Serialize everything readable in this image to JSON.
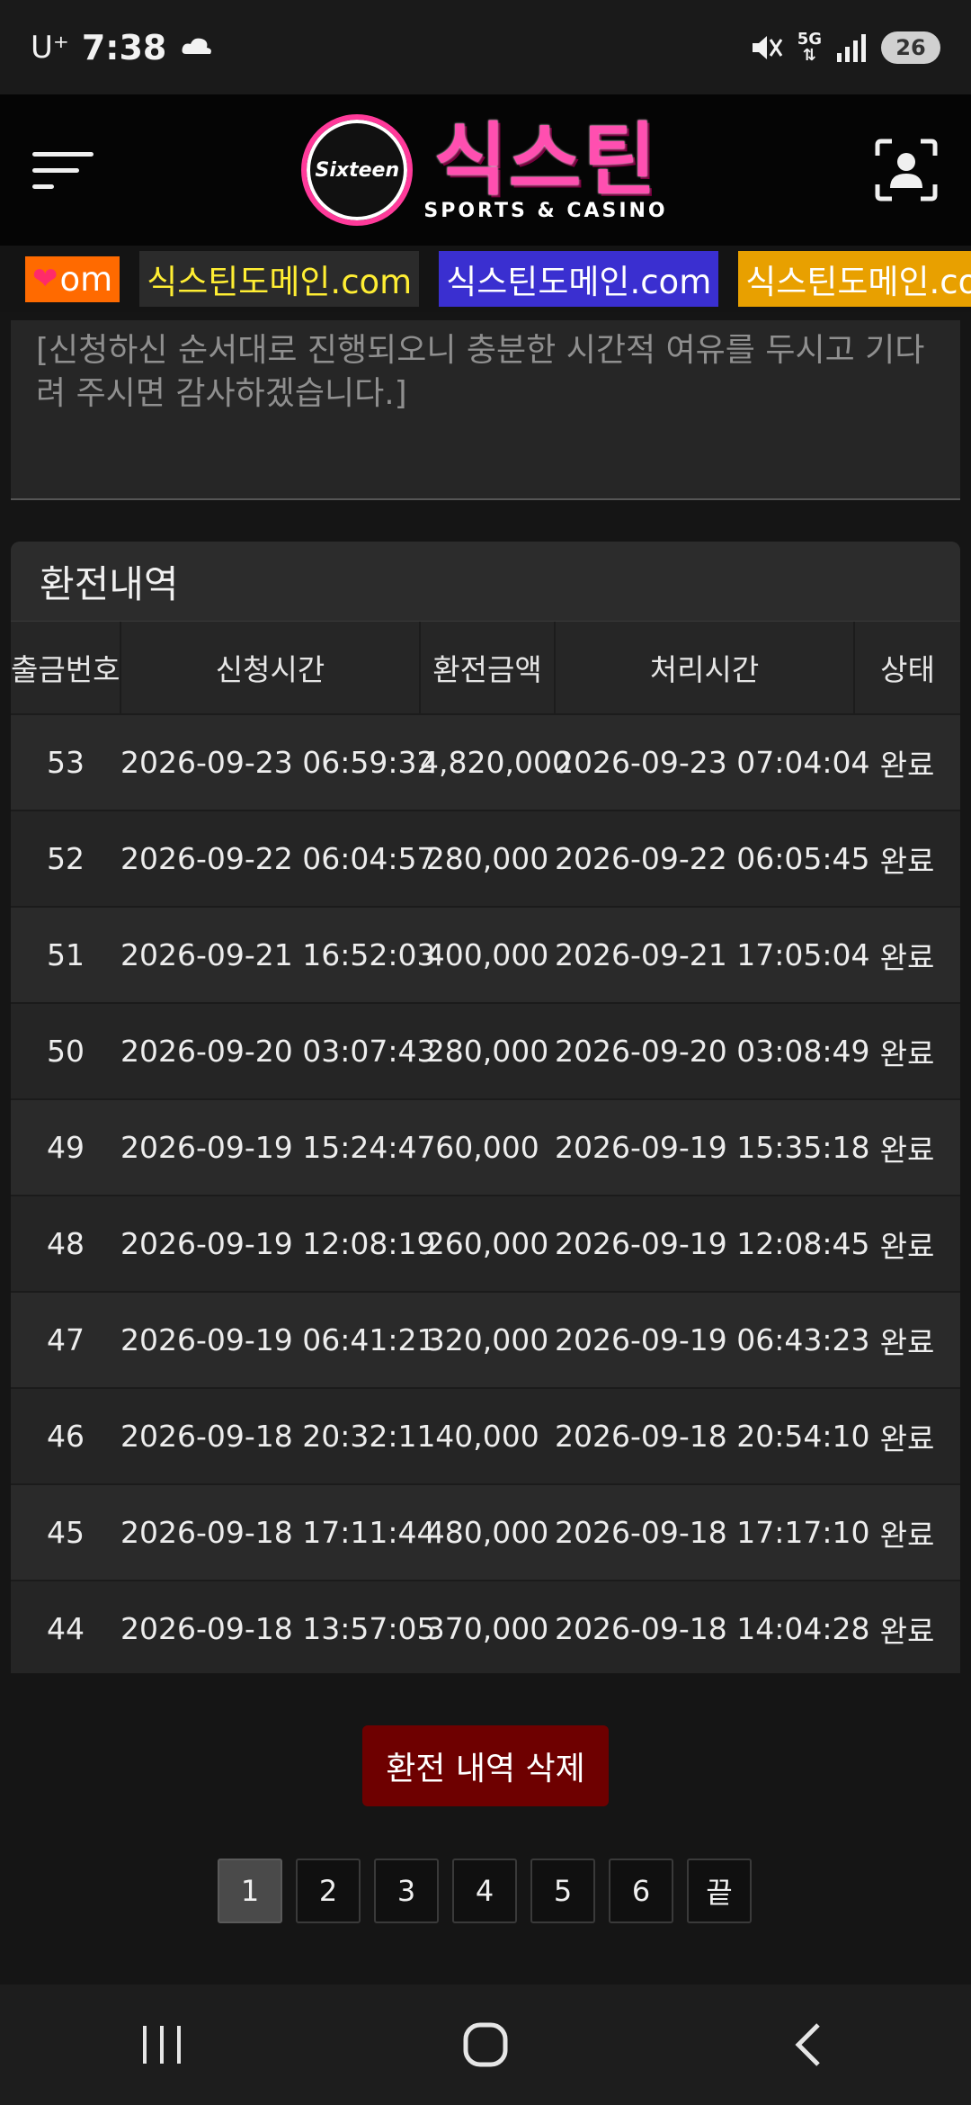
{
  "status_bar": {
    "carrier": "U⁺",
    "time": "7:38",
    "network": "5G",
    "battery": "26"
  },
  "header": {
    "logo_badge": "Sixteen",
    "logo_main": "식스틴",
    "logo_sub": "SPORTS & CASINO"
  },
  "banner": {
    "items": [
      "om",
      "식스틴도메인.com",
      "식스틴도메인.com",
      "식스틴도메인.cor"
    ]
  },
  "notice": {
    "text": "[신청하신 순서대로 진행되오니 충분한 시간적 여유를 두시고 기다려 주시면 감사하겠습니다.]"
  },
  "history": {
    "title": "환전내역",
    "columns": [
      "출금번호",
      "신청시간",
      "환전금액",
      "처리시간",
      "상태"
    ],
    "rows": [
      [
        "53",
        "2026-09-23 06:59:32",
        "4,820,000",
        "2026-09-23 07:04:04",
        "완료"
      ],
      [
        "52",
        "2026-09-22 06:04:57",
        "280,000",
        "2026-09-22 06:05:45",
        "완료"
      ],
      [
        "51",
        "2026-09-21 16:52:03",
        "400,000",
        "2026-09-21 17:05:04",
        "완료"
      ],
      [
        "50",
        "2026-09-20 03:07:43",
        "280,000",
        "2026-09-20 03:08:49",
        "완료"
      ],
      [
        "49",
        "2026-09-19 15:24:47",
        "60,000",
        "2026-09-19 15:35:18",
        "완료"
      ],
      [
        "48",
        "2026-09-19 12:08:19",
        "260,000",
        "2026-09-19 12:08:45",
        "완료"
      ],
      [
        "47",
        "2026-09-19 06:41:21",
        "320,000",
        "2026-09-19 06:43:23",
        "완료"
      ],
      [
        "46",
        "2026-09-18 20:32:11",
        "40,000",
        "2026-09-18 20:54:10",
        "완료"
      ],
      [
        "45",
        "2026-09-18 17:11:44",
        "480,000",
        "2026-09-18 17:17:10",
        "완료"
      ],
      [
        "44",
        "2026-09-18 13:57:05",
        "370,000",
        "2026-09-18 14:04:28",
        "완료"
      ]
    ]
  },
  "actions": {
    "delete_label": "환전 내역 삭제"
  },
  "pagination": {
    "pages": [
      "1",
      "2",
      "3",
      "4",
      "5",
      "6",
      "끝"
    ],
    "current": "1"
  },
  "colors": {
    "accent_pink": "#ff4fb0",
    "delete_red": "#6e0000"
  }
}
